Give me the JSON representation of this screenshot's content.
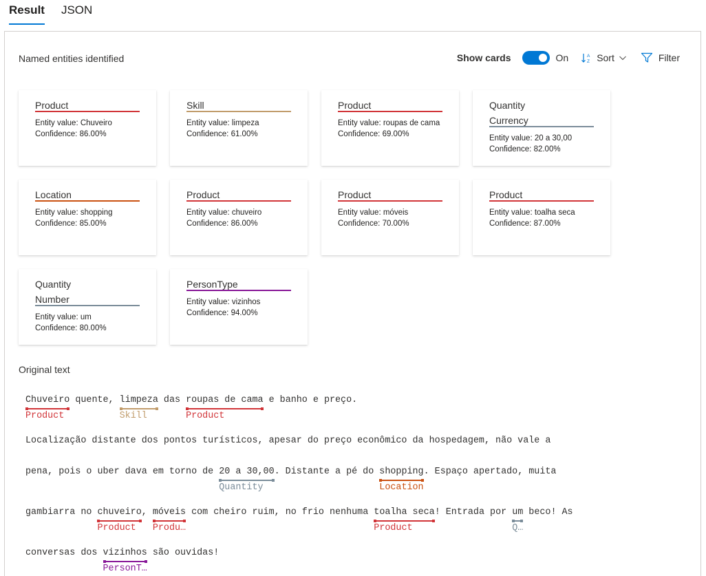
{
  "tabs": [
    {
      "label": "Result",
      "active": true
    },
    {
      "label": "JSON",
      "active": false
    }
  ],
  "heading": "Named entities identified",
  "toolbar": {
    "show_cards_label": "Show cards",
    "toggle_state": "On",
    "sort_label": "Sort",
    "filter_label": "Filter"
  },
  "colors": {
    "accent": "#0078d4",
    "product": "#d13438",
    "skill": "#c19c6b",
    "location": "#ca5010",
    "quantity": "#7a8c99",
    "persontype": "#881798"
  },
  "cards": [
    {
      "category": "Product",
      "entity_value": "Entity value: Chuveiro",
      "confidence": "Confidence: 86.00%"
    },
    {
      "category": "Skill",
      "entity_value": "Entity value: limpeza",
      "confidence": "Confidence: 61.00%"
    },
    {
      "category": "Product",
      "entity_value": "Entity value: roupas de cama",
      "confidence": "Confidence: 69.00%"
    },
    {
      "category": "Quantity",
      "subcategory": "Currency",
      "entity_value": "Entity value: 20 a 30,00",
      "confidence": "Confidence: 82.00%"
    },
    {
      "category": "Location",
      "entity_value": "Entity value: shopping",
      "confidence": "Confidence: 85.00%"
    },
    {
      "category": "Product",
      "entity_value": "Entity value: chuveiro",
      "confidence": "Confidence: 86.00%"
    },
    {
      "category": "Product",
      "entity_value": "Entity value: móveis",
      "confidence": "Confidence: 70.00%"
    },
    {
      "category": "Product",
      "entity_value": "Entity value: toalha seca",
      "confidence": "Confidence: 87.00%"
    },
    {
      "category": "Quantity",
      "subcategory": "Number",
      "entity_value": "Entity value: um",
      "confidence": "Confidence: 80.00%"
    },
    {
      "category": "PersonType",
      "entity_value": "Entity value: vizinhos",
      "confidence": "Confidence: 94.00%"
    }
  ],
  "original_text_label": "Original text",
  "original_text": {
    "line1": {
      "e1": "Chuveiro",
      "e1_tag": "Product",
      "t1": " quente, ",
      "e2": "limpeza",
      "e2_tag": "Skill",
      "t2": " das ",
      "e3": "roupas de cama",
      "e3_tag": "Product",
      "t3": " e banho e preço."
    },
    "line2": "Localização distante dos pontos turísticos, apesar do preço econômico da hospedagem, não vale a",
    "line3": {
      "t1": "pena, pois o uber dava em torno de ",
      "e1": "20 a 30,00",
      "e1_tag": "Quantity",
      "t2": ". Distante a pé do ",
      "e2": "shopping",
      "e2_tag": "Location",
      "t3": ". Espaço apertado, muita"
    },
    "line4": {
      "t1": "gambiarra no ",
      "e1": "chuveiro",
      "e1_tag": "Product",
      "t2": ", ",
      "e2": "móveis",
      "e2_tag": "Produ…",
      "t3": " com cheiro ruim, no frio nenhuma ",
      "e3": "toalha seca",
      "e3_tag": "Product",
      "t4": "! Entrada por ",
      "e4": "um",
      "e4_tag": "Q…",
      "t5": " beco! As"
    },
    "line5": {
      "t1": "conversas dos ",
      "e1": "vizinhos",
      "e1_tag": "PersonT…",
      "t2": " são ouvidas!"
    }
  }
}
